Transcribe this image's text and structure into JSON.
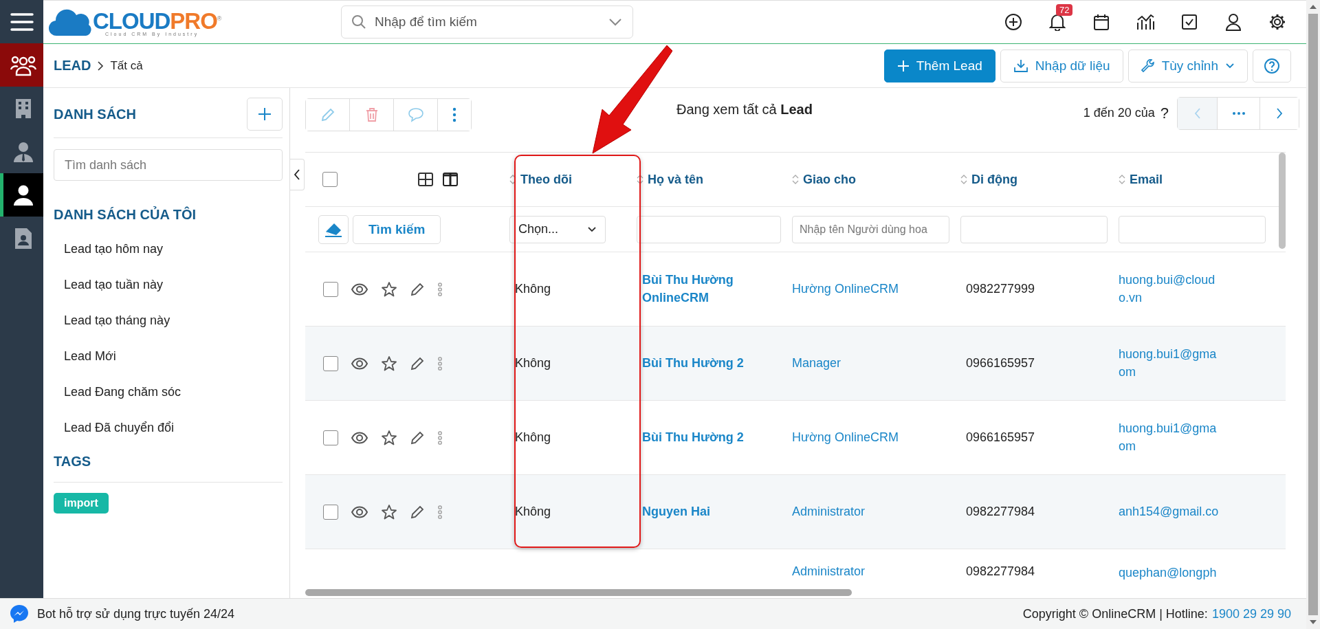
{
  "nav_rail": {
    "items": [
      {
        "kind": "group",
        "highlighted": true,
        "selected": false
      },
      {
        "kind": "building",
        "highlighted": false,
        "selected": false
      },
      {
        "kind": "agent",
        "highlighted": false,
        "selected": false
      },
      {
        "kind": "person",
        "highlighted": false,
        "selected": true
      },
      {
        "kind": "contact",
        "highlighted": false,
        "selected": false
      }
    ]
  },
  "logo": {
    "part1": "CLOUD",
    "part2": "PRO",
    "mark": "®",
    "tagline": "Cloud CRM By Industry"
  },
  "search": {
    "placeholder": "Nhập để tìm kiếm"
  },
  "header_icons": [
    {
      "kind": "add"
    },
    {
      "kind": "bell",
      "badge": "72"
    },
    {
      "kind": "calendar"
    },
    {
      "kind": "chart"
    },
    {
      "kind": "task"
    },
    {
      "kind": "user"
    },
    {
      "kind": "settings"
    }
  ],
  "breadcrumb": {
    "module": "LEAD",
    "current": "Tất cả"
  },
  "actions": [
    {
      "kind": "primary",
      "label": "Thêm Lead"
    },
    {
      "kind": "import",
      "label": "Nhập dữ liệu"
    },
    {
      "kind": "menu",
      "label": "Tùy chỉnh"
    },
    {
      "kind": "help"
    }
  ],
  "lists_panel": {
    "title": "DANH SÁCH",
    "search_placeholder": "Tìm danh sách",
    "section": "DANH SÁCH CỦA TÔI",
    "items": [
      "Lead tạo hôm nay",
      "Lead tạo tuần này",
      "Lead tạo tháng này",
      "Lead Mới",
      "Lead Đang chăm sóc",
      "Lead Đã chuyển đổi"
    ],
    "tags_title": "TAGS",
    "tags": [
      {
        "label": "import",
        "color": "#17b8a6"
      }
    ]
  },
  "toolbar": {
    "tools": [
      {
        "kind": "edit"
      },
      {
        "kind": "delete"
      },
      {
        "kind": "comment"
      },
      {
        "kind": "more"
      }
    ],
    "viewing": "Đang xem tất cả **Lead**",
    "range": "1 đến 20 của",
    "total": "?"
  },
  "table": {
    "select_all_checked": false,
    "filter_button": "Tìm kiếm",
    "columns": [
      {
        "label": "Theo dõi",
        "filter": {
          "kind": "select",
          "value": "Chọn..."
        }
      },
      {
        "label": "Họ và tên",
        "filter": {
          "kind": "text"
        }
      },
      {
        "label": "Giao cho",
        "filter": {
          "kind": "text",
          "placeholder": "Nhập tên Người dùng hoa"
        }
      },
      {
        "label": "Di động",
        "filter": {
          "kind": "text"
        }
      },
      {
        "label": "Email",
        "filter": {
          "kind": "text"
        }
      }
    ],
    "rows": [
      {
        "checked": false,
        "follow": "Không",
        "name": [
          "Bùi Thu Hường",
          "OnlineCRM"
        ],
        "assigned": "Hường OnlineCRM",
        "mobile": "0982277999",
        "email": [
          "huong.bui@cloud",
          "o.vn"
        ]
      },
      {
        "checked": false,
        "follow": "Không",
        "name": [
          "Bùi Thu Hường 2"
        ],
        "assigned": "Manager",
        "mobile": "0966165957",
        "email": [
          "huong.bui1@gma",
          "om"
        ]
      },
      {
        "checked": false,
        "follow": "Không",
        "name": [
          "Bùi Thu Hường 2"
        ],
        "assigned": "Hường OnlineCRM",
        "mobile": "0966165957",
        "email": [
          "huong.bui1@gma",
          "om"
        ]
      },
      {
        "checked": false,
        "follow": "Không",
        "name": [
          "Nguyen Hai"
        ],
        "assigned": "Administrator",
        "mobile": "0982277984",
        "email": [
          "anh154@gmail.co"
        ]
      },
      {
        "assigned": "Administrator",
        "mobile": "0982277984",
        "email": [
          "quephan@longph"
        ]
      }
    ]
  },
  "footer": {
    "bot": "Bot hỗ trợ sử dụng trực tuyến 24/24",
    "copyright": "Copyright © OnlineCRM | Hotline:",
    "hotline": "1900 29 29 90"
  }
}
